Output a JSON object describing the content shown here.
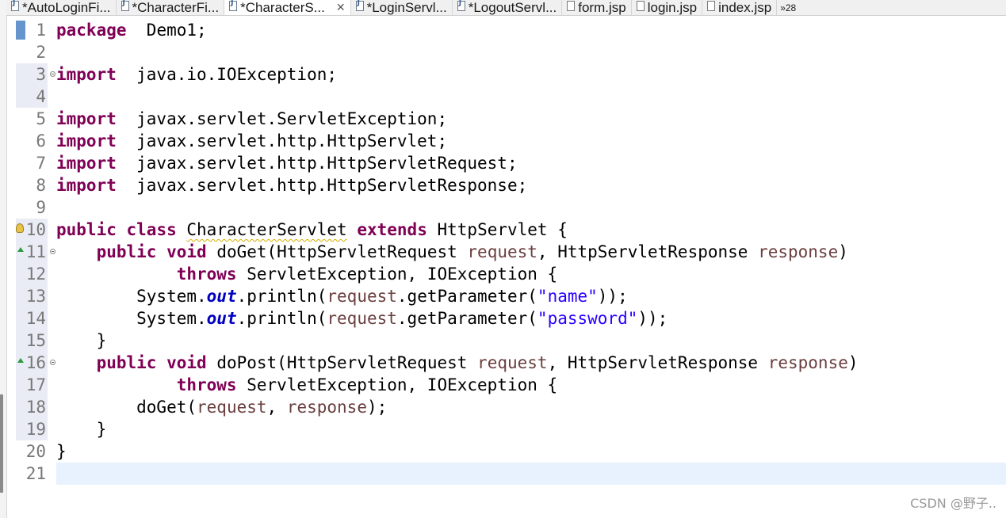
{
  "tabs": [
    {
      "label": "*AutoLoginFi...",
      "icon": "java-file-icon",
      "active": false
    },
    {
      "label": "*CharacterFi...",
      "icon": "java-file-icon",
      "active": false
    },
    {
      "label": "*CharacterS...",
      "icon": "java-file-icon",
      "active": true,
      "close": "✕"
    },
    {
      "label": "*LoginServl...",
      "icon": "java-file-icon",
      "active": false
    },
    {
      "label": "*LogoutServl...",
      "icon": "java-file-icon",
      "active": false
    },
    {
      "label": "form.jsp",
      "icon": "jsp-file-icon",
      "active": false
    },
    {
      "label": "login.jsp",
      "icon": "jsp-file-icon",
      "active": false
    },
    {
      "label": "index.jsp",
      "icon": "jsp-file-icon",
      "active": false
    },
    {
      "label": "»28",
      "icon": "overflow-icon",
      "active": false
    }
  ],
  "gutter": {
    "line_numbers": [
      "1",
      "2",
      "3",
      "4",
      "5",
      "6",
      "7",
      "8",
      "9",
      "10",
      "11",
      "12",
      "13",
      "14",
      "15",
      "16",
      "17",
      "18",
      "19",
      "20",
      "21"
    ]
  },
  "code": [
    [
      [
        "kw",
        "package"
      ],
      [
        "",
        "  Demo1;"
      ]
    ],
    [],
    [
      [
        "kw",
        "import"
      ],
      [
        "",
        "  java.io.IOException;"
      ]
    ],
    [],
    [
      [
        "kw",
        "import"
      ],
      [
        "",
        "  javax.servlet.ServletException;"
      ]
    ],
    [
      [
        "kw",
        "import"
      ],
      [
        "",
        "  javax.servlet.http.HttpServlet;"
      ]
    ],
    [
      [
        "kw",
        "import"
      ],
      [
        "",
        "  javax.servlet.http.HttpServletRequest;"
      ]
    ],
    [
      [
        "kw",
        "import"
      ],
      [
        "",
        "  javax.servlet.http.HttpServletResponse;"
      ]
    ],
    [],
    [
      [
        "kw",
        "public"
      ],
      [
        "",
        " "
      ],
      [
        "kw",
        "class"
      ],
      [
        "",
        " "
      ],
      [
        "warn",
        "CharacterServlet"
      ],
      [
        "",
        " "
      ],
      [
        "kw",
        "extends"
      ],
      [
        "",
        " HttpServlet {"
      ]
    ],
    [
      [
        "",
        "    "
      ],
      [
        "kw",
        "public"
      ],
      [
        "",
        " "
      ],
      [
        "kw",
        "void"
      ],
      [
        "",
        " doGet(HttpServletRequest "
      ],
      [
        "param",
        "request"
      ],
      [
        "",
        ", HttpServletResponse "
      ],
      [
        "param",
        "response"
      ],
      [
        "",
        ")"
      ]
    ],
    [
      [
        "",
        "            "
      ],
      [
        "kw",
        "throws"
      ],
      [
        "",
        " ServletException, IOException {"
      ]
    ],
    [
      [
        "",
        "        System."
      ],
      [
        "static-field",
        "out"
      ],
      [
        "",
        ".println("
      ],
      [
        "param",
        "request"
      ],
      [
        "",
        ".getParameter("
      ],
      [
        "str",
        "\"name\""
      ],
      [
        "",
        "));"
      ]
    ],
    [
      [
        "",
        "        System."
      ],
      [
        "static-field",
        "out"
      ],
      [
        "",
        ".println("
      ],
      [
        "param",
        "request"
      ],
      [
        "",
        ".getParameter("
      ],
      [
        "str",
        "\"password\""
      ],
      [
        "",
        "));"
      ]
    ],
    [
      [
        "",
        "    }"
      ]
    ],
    [
      [
        "",
        "    "
      ],
      [
        "kw",
        "public"
      ],
      [
        "",
        " "
      ],
      [
        "kw",
        "void"
      ],
      [
        "",
        " doPost(HttpServletRequest "
      ],
      [
        "param",
        "request"
      ],
      [
        "",
        ", HttpServletResponse "
      ],
      [
        "param",
        "response"
      ],
      [
        "",
        ")"
      ]
    ],
    [
      [
        "",
        "            "
      ],
      [
        "kw",
        "throws"
      ],
      [
        "",
        " ServletException, IOException {"
      ]
    ],
    [
      [
        "",
        "        doGet("
      ],
      [
        "param",
        "request"
      ],
      [
        "",
        ", "
      ],
      [
        "param",
        "response"
      ],
      [
        "",
        ");"
      ]
    ],
    [
      [
        "",
        "    }"
      ]
    ],
    [
      [
        "",
        "}"
      ]
    ],
    []
  ],
  "watermark": "CSDN @野子.."
}
